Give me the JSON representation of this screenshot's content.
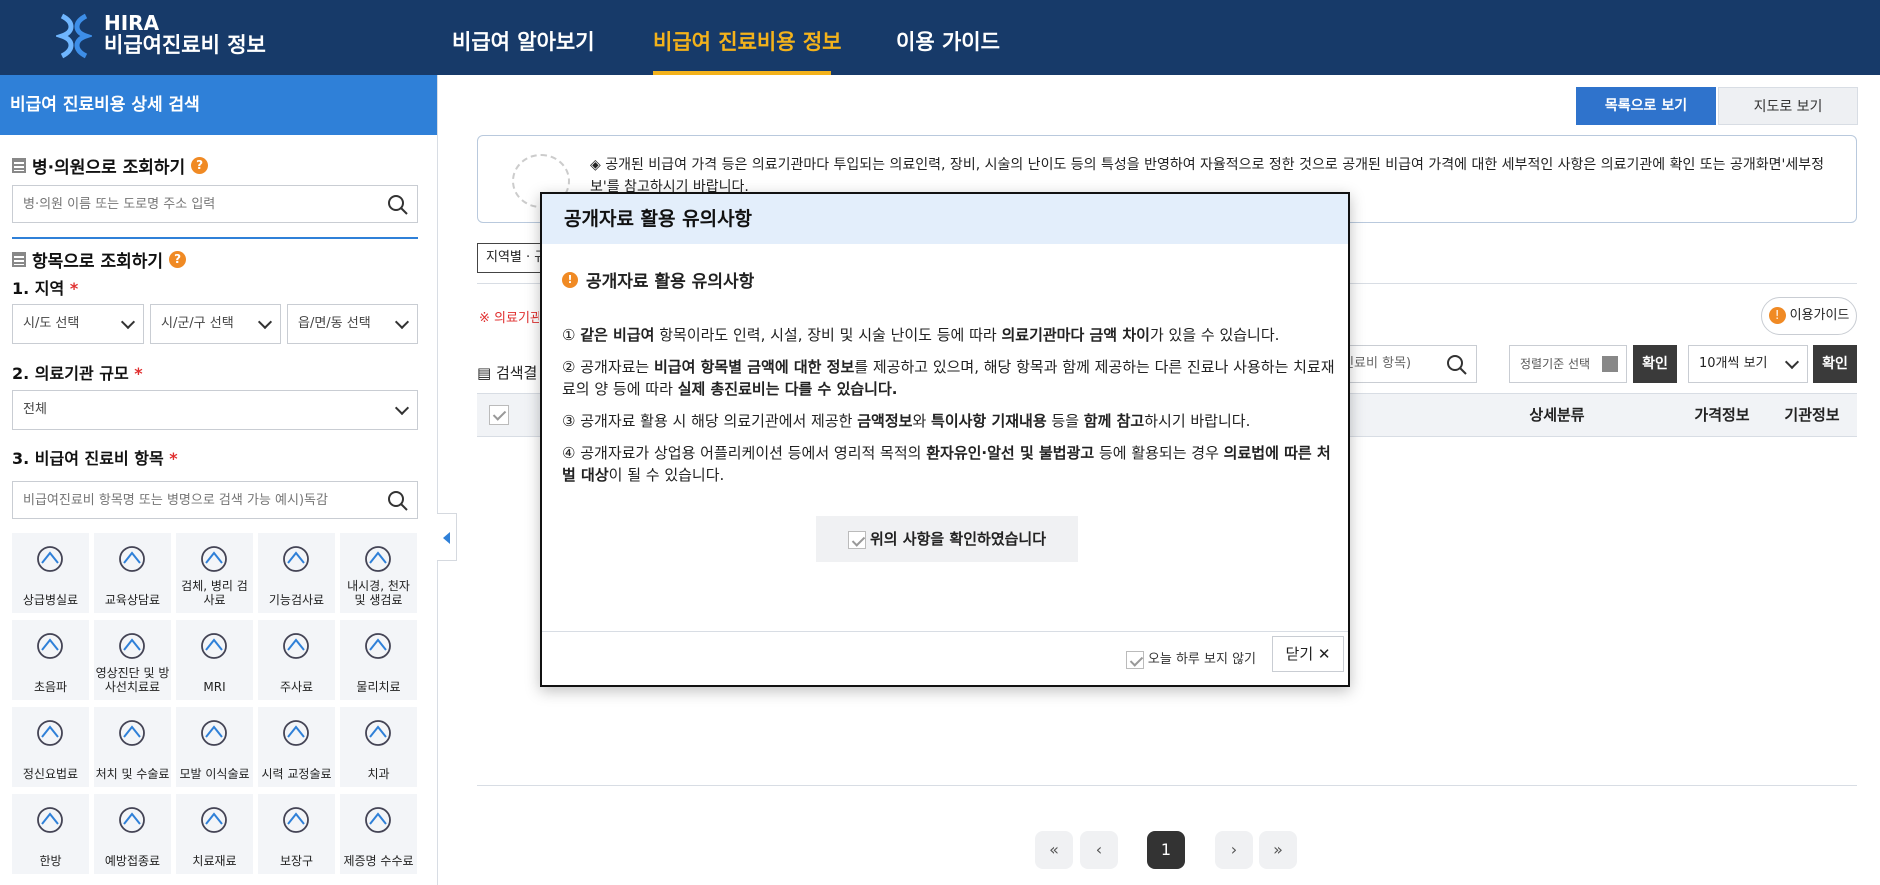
{
  "header": {
    "logo_line1": "HIRA",
    "logo_line2": "비급여진료비 정보",
    "nav": [
      "비급여 알아보기",
      "비급여 진료비용 정보",
      "이용 가이드"
    ],
    "active_nav_color": "#f3b21b",
    "bg_color": "#173a69"
  },
  "sidebar": {
    "title": "비급여 진료비용 상세 검색",
    "hospital_search": {
      "title": "병·의원으로 조회하기",
      "placeholder": "병·의원 이름 또는 도로명 주소 입력"
    },
    "item_search": {
      "title": "항목으로 조회하기",
      "region_label": "1. 지역",
      "region_selects": [
        "시/도 선택",
        "시/군/구 선택",
        "읍/면/동 선택"
      ],
      "scale_label": "2. 의료기관 규모",
      "scale_value": "전체",
      "category_label": "3. 비급여 진료비 항목",
      "category_placeholder": "비급여진료비 항목명 또는 병명으로 검색 가능 예시)독감"
    },
    "categories": [
      {
        "label": "상급병실료",
        "icon": "bed-icon"
      },
      {
        "label": "교육상담료",
        "icon": "counsel-icon"
      },
      {
        "label": "검체, 병리 검사료",
        "icon": "lab-icon"
      },
      {
        "label": "기능검사료",
        "icon": "function-test-icon"
      },
      {
        "label": "내시경, 천자 및 생검료",
        "icon": "endoscope-icon"
      },
      {
        "label": "초음파",
        "icon": "ultrasound-icon"
      },
      {
        "label": "영상진단 및 방사선치료료",
        "icon": "radiology-icon"
      },
      {
        "label": "MRI",
        "icon": "mri-icon"
      },
      {
        "label": "주사료",
        "icon": "injection-icon"
      },
      {
        "label": "물리치료",
        "icon": "physio-icon"
      },
      {
        "label": "정신요법료",
        "icon": "psych-icon"
      },
      {
        "label": "처치 및 수술료",
        "icon": "surgery-icon"
      },
      {
        "label": "모발 이식술료",
        "icon": "hair-icon"
      },
      {
        "label": "시력 교정술료",
        "icon": "eye-icon"
      },
      {
        "label": "치과",
        "icon": "tooth-icon"
      },
      {
        "label": "한방",
        "icon": "oriental-icon"
      },
      {
        "label": "예방접종료",
        "icon": "vaccine-icon"
      },
      {
        "label": "치료재료",
        "icon": "material-icon"
      },
      {
        "label": "보장구",
        "icon": "wheelchair-icon"
      },
      {
        "label": "제증명 수수료",
        "icon": "certificate-icon"
      }
    ]
  },
  "main": {
    "view_list": "목록으로 보기",
    "view_map": "지도로 보기",
    "notice": "◈ 공개된 비급여 가격 등은 의료기관마다 투입되는 의료인력, 장비, 시술의 난이도 등의 특성을 반영하여 자율적으로 정한 것으로 공개된 비급여 가격에 대한 세부적인 사항은 의료기관에 확인 또는 공개화면'세부정보'를 참고하시기 바랍니다.",
    "filter_chip": "지역별 · 규",
    "red_note": "※ 의료기관",
    "guide": "이용가이드",
    "result_label": "검색결",
    "search_partial": "는 진료비 항목)",
    "sort": "정렬기준 선택",
    "confirm": "확인",
    "page_size": "10개씩 보기",
    "columns": [
      "상세분류",
      "가격정보",
      "기관정보"
    ],
    "pages": {
      "first": "«",
      "prev": "‹",
      "current": "1",
      "next": "›",
      "last": "»"
    }
  },
  "modal": {
    "title": "공개자료 활용 유의사항",
    "subtitle": "공개자료 활용 유의사항",
    "l1a": "① ",
    "l1b": "같은 비급여",
    "l1c": " 항목이라도 인력, 시설, 장비 및 시술 난이도 등에 따라 ",
    "l1d": "의료기관마다 금액 차이",
    "l1e": "가 있을 수 있습니다.",
    "l2a": "② 공개자료는 ",
    "l2b": "비급여 항목별 금액에 대한 정보",
    "l2c": "를 제공하고 있으며, 해당 항목과 함께 제공하는 다른 진료나 사용하는 치료재료의 양 등에 따라 ",
    "l2d": "실제 총진료비는 다를 수 있습니다.",
    "l3a": "③ 공개자료 활용 시 해당 의료기관에서 제공한 ",
    "l3b": "금액정보",
    "l3c": "와 ",
    "l3d": "특이사항 기재내용",
    "l3e": " 등을 ",
    "l3f": "함께 참고",
    "l3g": "하시기 바랍니다.",
    "l4a": "④ 공개자료가 상업용 어플리케이션 등에서 영리적 목적의 ",
    "l4b": "환자유인·알선 및 불법광고",
    "l4c": " 등에 활용되는 경우 ",
    "l4d": "의료법에 따른 처벌 대상",
    "l4e": "이 될 수 있습니다.",
    "confirm_check": "위의 사항을 확인하였습니다",
    "today_hide": "오늘 하루 보지 않기",
    "close": "닫기 ✕"
  }
}
